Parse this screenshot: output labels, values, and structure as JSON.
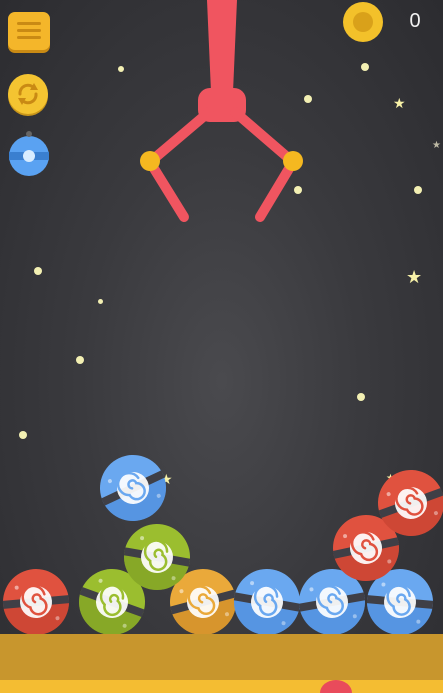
{
  "hud": {
    "score": "0",
    "icons": {
      "menu": "hamburger-menu-icon",
      "restart": "restart-icon",
      "drop": "blue-ball-icon",
      "coin": "coin-icon"
    }
  },
  "colors": {
    "background": "#3a3a3e",
    "claw": "#f05560",
    "claw_joint": "#f5b820",
    "ground": "#c8962d",
    "ground_lip": "#f4bd32",
    "ball_red": "#e0523f",
    "ball_green": "#9bbe2f",
    "ball_blue": "#6aa8f0",
    "ball_orange": "#eaa93a"
  },
  "balls": [
    {
      "id": "ball-red-1",
      "color": "red"
    },
    {
      "id": "ball-green-1",
      "color": "green"
    },
    {
      "id": "ball-orange-1",
      "color": "orange"
    },
    {
      "id": "ball-blue-1",
      "color": "blue"
    },
    {
      "id": "ball-blue-2",
      "color": "blue"
    },
    {
      "id": "ball-blue-3",
      "color": "blue"
    },
    {
      "id": "ball-blue-4",
      "color": "blue"
    },
    {
      "id": "ball-green-2",
      "color": "green"
    },
    {
      "id": "ball-red-2",
      "color": "red"
    },
    {
      "id": "ball-red-3",
      "color": "red"
    }
  ]
}
